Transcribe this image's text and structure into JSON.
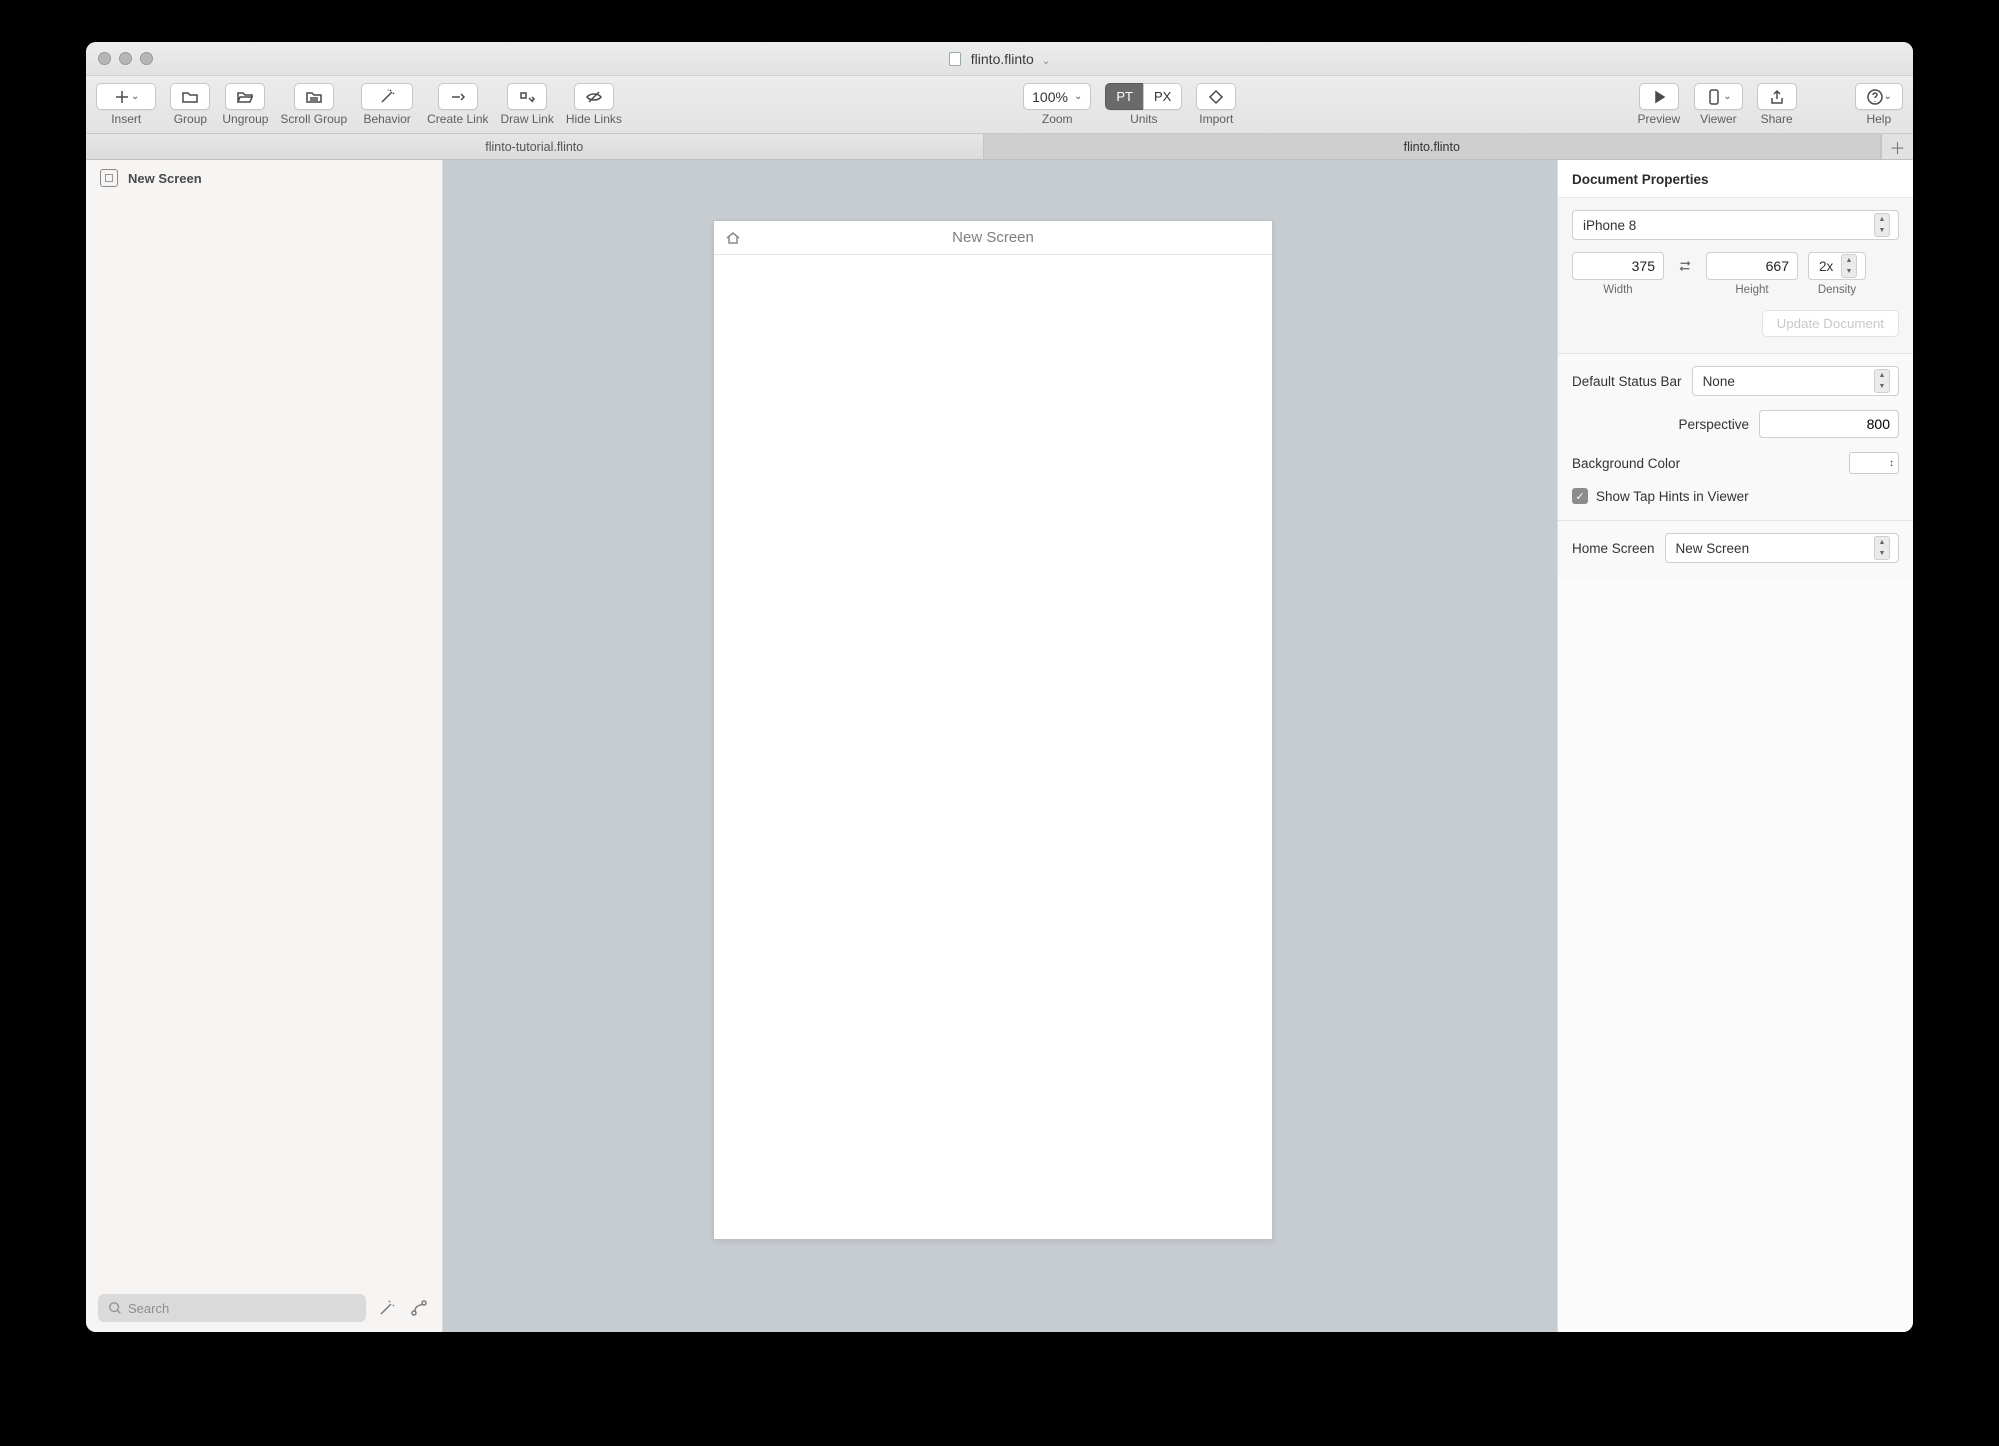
{
  "window": {
    "title": "flinto.flinto"
  },
  "toolbar": {
    "insert": "Insert",
    "group": "Group",
    "ungroup": "Ungroup",
    "scrollGroup": "Scroll Group",
    "behavior": "Behavior",
    "createLink": "Create Link",
    "drawLink": "Draw Link",
    "hideLinks": "Hide Links",
    "zoomValue": "100%",
    "zoomLabel": "Zoom",
    "unitsPT": "PT",
    "unitsPX": "PX",
    "unitsLabel": "Units",
    "import": "Import",
    "preview": "Preview",
    "viewer": "Viewer",
    "share": "Share",
    "help": "Help"
  },
  "tabs": {
    "t1": "flinto-tutorial.flinto",
    "t2": "flinto.flinto"
  },
  "sidebar": {
    "item1": "New Screen",
    "searchPlaceholder": "Search"
  },
  "canvas": {
    "screenTitle": "New Screen"
  },
  "inspector": {
    "title": "Document Properties",
    "device": "iPhone 8",
    "width": "375",
    "widthLabel": "Width",
    "height": "667",
    "heightLabel": "Height",
    "density": "2x",
    "densityLabel": "Density",
    "updateDoc": "Update Document",
    "statusBarLabel": "Default Status Bar",
    "statusBarValue": "None",
    "perspectiveLabel": "Perspective",
    "perspectiveValue": "800",
    "bgColorLabel": "Background Color",
    "tapHints": "Show Tap Hints in Viewer",
    "homeScreenLabel": "Home Screen",
    "homeScreenValue": "New Screen"
  }
}
